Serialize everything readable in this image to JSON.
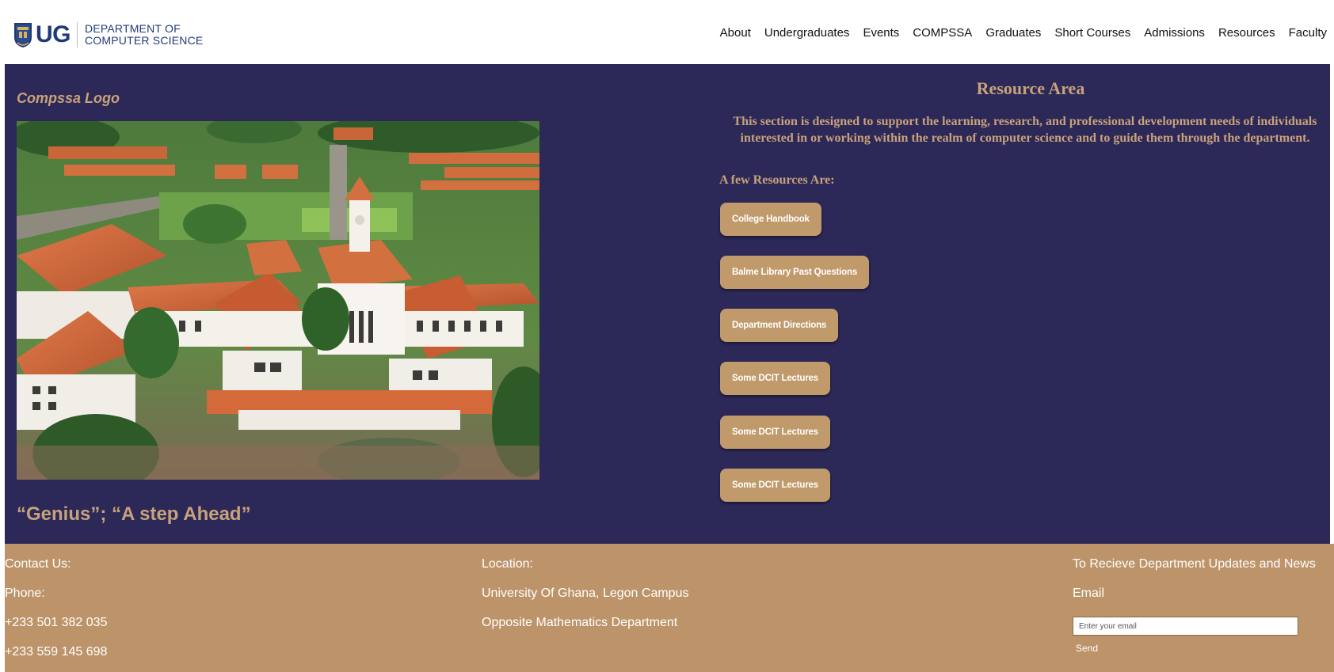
{
  "header": {
    "logo_ug": "UG",
    "logo_dept_line1": "DEPARTMENT OF",
    "logo_dept_line2": "COMPUTER SCIENCE",
    "nav": [
      "About",
      "Undergraduates",
      "Events",
      "COMPSSA",
      "Graduates",
      "Short Courses",
      "Admissions",
      "Resources",
      "Faculty"
    ]
  },
  "main": {
    "logo_caption": "Compssa Logo",
    "slogan": "“Genius”; “A step Ahead”",
    "resource_title": "Resource Area",
    "resource_description": "This section is designed to support the learning, research, and professional development needs of individuals interested in or working within the realm of computer science and to guide them through the department.",
    "resource_subheading": "A few Resources Are:",
    "resources": [
      "College Handbook",
      "Balme Library Past Questions",
      "Department Directions",
      "Some DCIT Lectures",
      "Some DCIT Lectures",
      "Some DCIT Lectures"
    ]
  },
  "footer": {
    "contact_heading": "Contact Us:",
    "phone_label": "Phone:",
    "phone_1": "+233 501 382 035",
    "phone_2": "+233 559 145 698",
    "location_heading": "Location:",
    "location_line1": "University Of Ghana, Legon Campus",
    "location_line2": "Opposite Mathematics Department",
    "updates_heading": "To Recieve Department Updates and News",
    "email_label": "Email",
    "email_placeholder": "Enter your email",
    "send_label": "Send"
  },
  "colors": {
    "main_background": "#2c2858",
    "accent_gold": "#c7a27a",
    "button_background": "#c09a6b",
    "footer_background": "#bd946a",
    "brand_blue": "#1f3a7a"
  }
}
